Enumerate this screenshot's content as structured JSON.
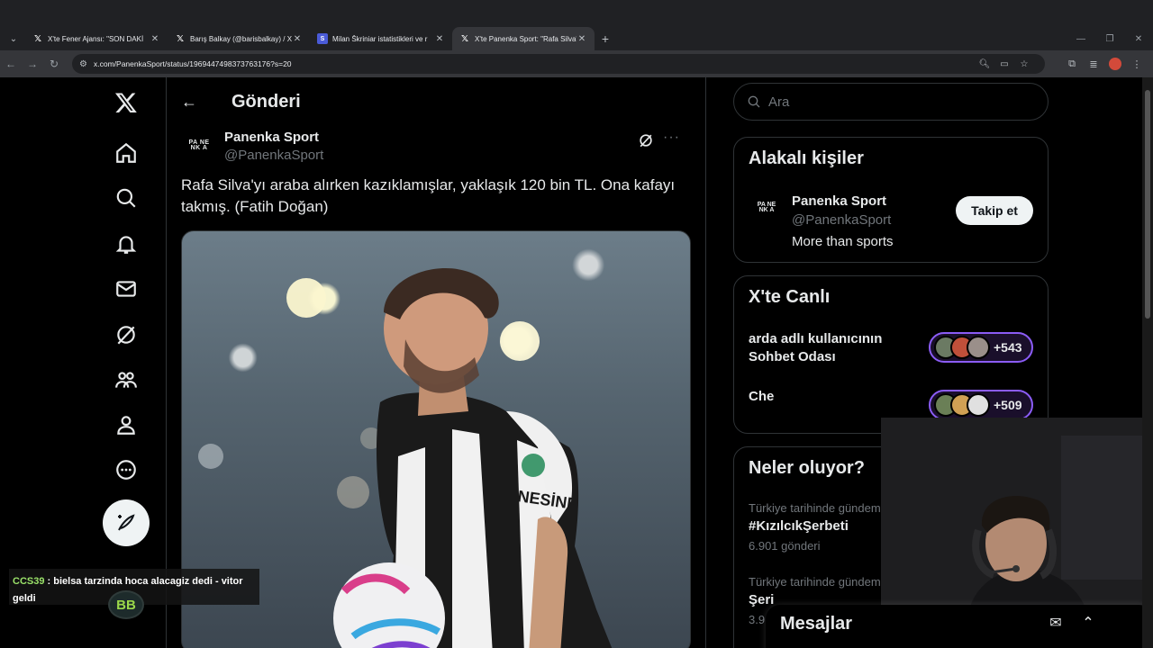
{
  "browser": {
    "tabs": [
      {
        "title": "X'te Fener Ajansı: \"SON DAKİ",
        "icon": "x-icon"
      },
      {
        "title": "Barış Balkay (@barisbalkay) / X",
        "icon": "x-icon"
      },
      {
        "title": "Milan Škriniar istatistikleri ve r",
        "icon": "milan-icon"
      },
      {
        "title": "X'te Panenka Sport: \"Rafa Silva'",
        "icon": "x-icon"
      }
    ],
    "active_tab_index": 3,
    "url": "x.com/PanenkaSport/status/1969447498373763176?s=20"
  },
  "page": {
    "header_title": "Gönderi",
    "tweet": {
      "author_name": "Panenka Sport",
      "author_handle": "@PanenkaSport",
      "avatar_logo": "PA NE NK A",
      "text": "Rafa Silva'yı araba alırken kazıklamışlar, yaklaşık 120 bin TL. Ona kafayı takmış. (Fatih Doğan)",
      "media_jersey_text": "NESİNE",
      "media_alt": "photo"
    }
  },
  "right": {
    "search_placeholder": "Ara",
    "people": {
      "title": "Alakalı kişiler",
      "name": "Panenka Sport",
      "handle": "@PanenkaSport",
      "bio": "More than sports",
      "follow_label": "Takip et"
    },
    "live": {
      "title": "X'te Canlı",
      "spaces": [
        {
          "title": "arda adlı kullanıcının Sohbet Odası",
          "count": "+543"
        },
        {
          "title": "Che",
          "count": "+509"
        }
      ]
    },
    "whats": {
      "title": "Neler oluyor?",
      "trends": [
        {
          "category": "Türkiye tarihinde gündem",
          "name": "#KızılcıkŞerbeti",
          "count": "6.901 gönderi"
        },
        {
          "category": "Türkiye tarihinde gündem",
          "name": "Şeri",
          "count": "3.9"
        }
      ]
    }
  },
  "drawer": {
    "title": "Mesajlar"
  },
  "chat": {
    "user": "CCS39",
    "message": " : bielsa tarzinda hoca alacagiz dedi - vitor geldi",
    "badge": "BB"
  },
  "colors": {
    "accent": "#1d9bf0",
    "space_border": "#8b5cf6",
    "background": "#000000"
  }
}
